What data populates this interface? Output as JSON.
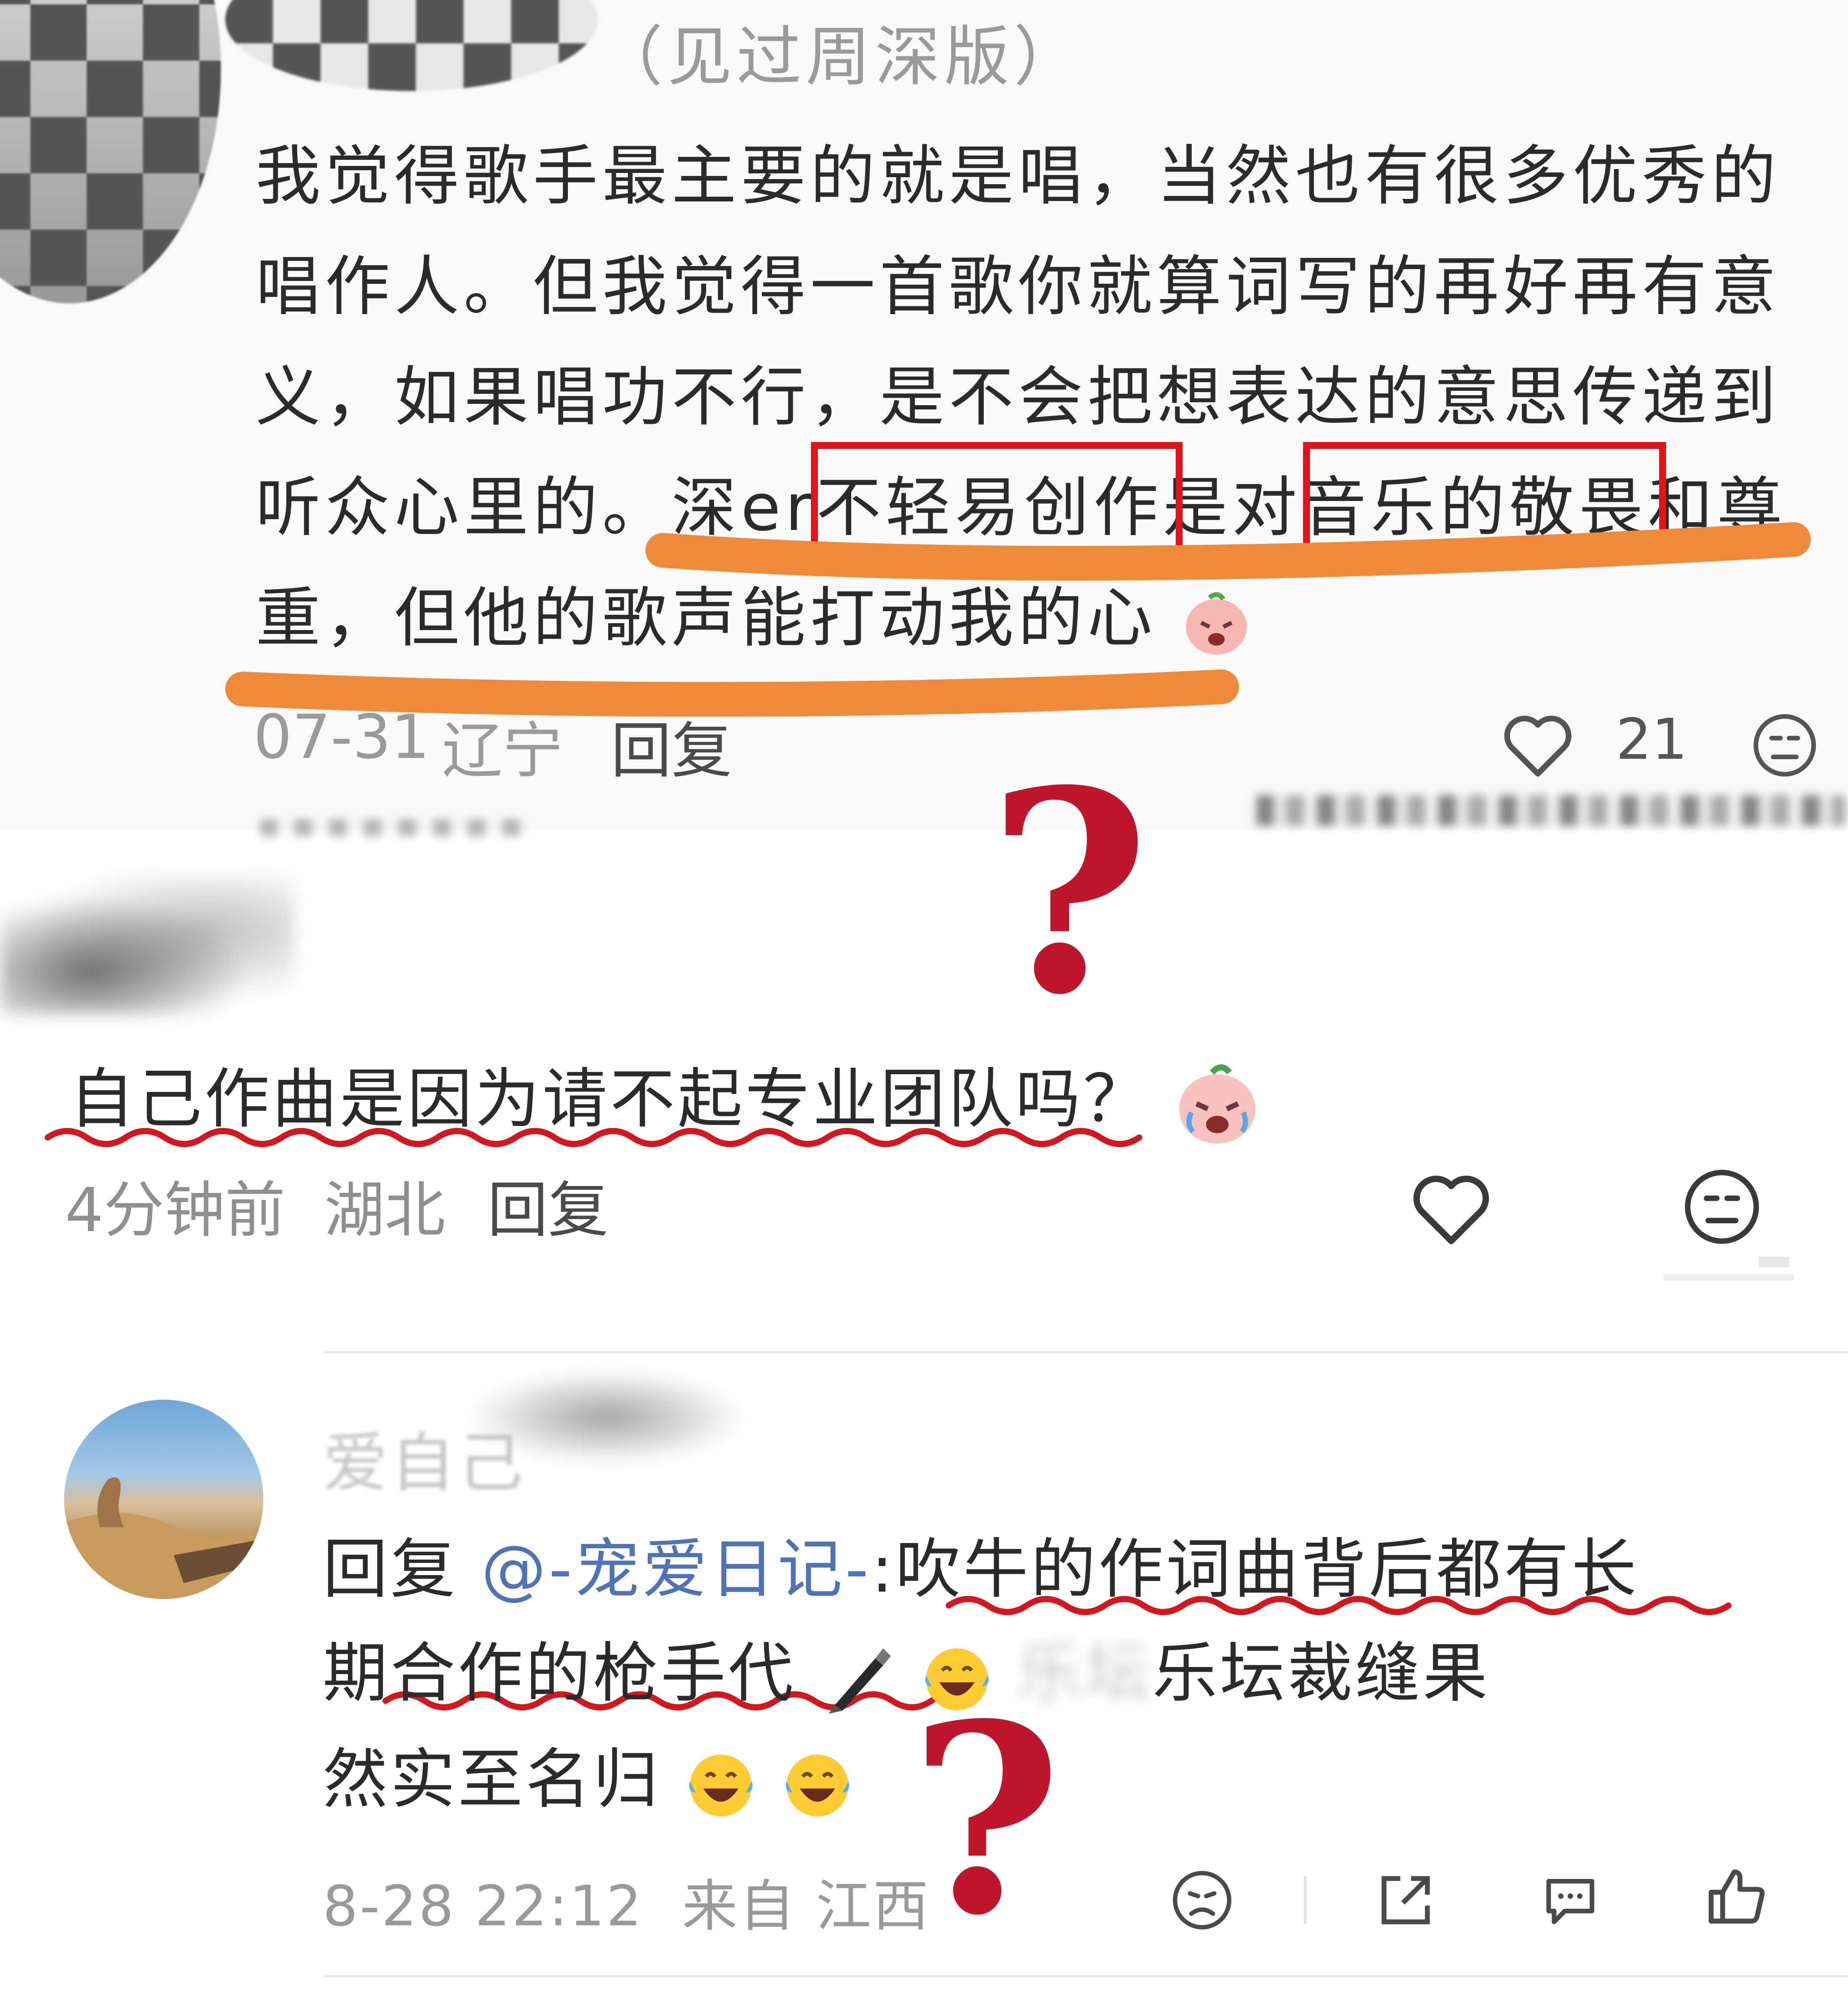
{
  "comment1": {
    "username_suffix": "（见过周深版）",
    "lines": [
      "我觉得歌手最主要的就是唱，当然也有很多优秀的",
      "唱作人。但我觉得一首歌你就算词写的再好再有意",
      "义，如果唱功不行，是不会把想表达的意思传递到"
    ],
    "line4": {
      "a": "听众心里的。深er",
      "highlight1": "不轻易创作",
      "b": "是对",
      "highlight2": "音乐的敬畏",
      "c": "和尊"
    },
    "line5": "重，但他的歌声能打动我的心",
    "date": "07-31",
    "location": "辽宁",
    "reply_label": "回复",
    "like_count": "21"
  },
  "comment2": {
    "text": "自己作曲是因为请不起专业团队吗？",
    "time": "4分钟前",
    "location": "湖北",
    "reply_label": "回复"
  },
  "comment3": {
    "username": "爱自己",
    "reply_prefix": "回复 ",
    "mention": "@-宠爱日记-",
    "line1_rest": ":吹牛的作词曲背后都有长",
    "line2_a": "期合作的枪手代",
    "line2_blur": "乐坛",
    "line2_b": "乐坛裁缝果",
    "line3": "然实至名归",
    "datetime": "8-28 22:12",
    "source": "来自 江西"
  },
  "annotations": {
    "question_mark": "?"
  },
  "colors": {
    "highlight_box": "#e0161c",
    "orange_underline": "#f08a3a",
    "red_wavy": "#d4161f",
    "question_mark": "#c0162b",
    "mention": "#4f72b8"
  },
  "icons": [
    "heart-icon",
    "dislike-face-icon",
    "share-icon",
    "comment-icon",
    "thumbs-up-icon",
    "crying-peach-emoji",
    "laughing-tears-emoji",
    "pen-emoji"
  ]
}
